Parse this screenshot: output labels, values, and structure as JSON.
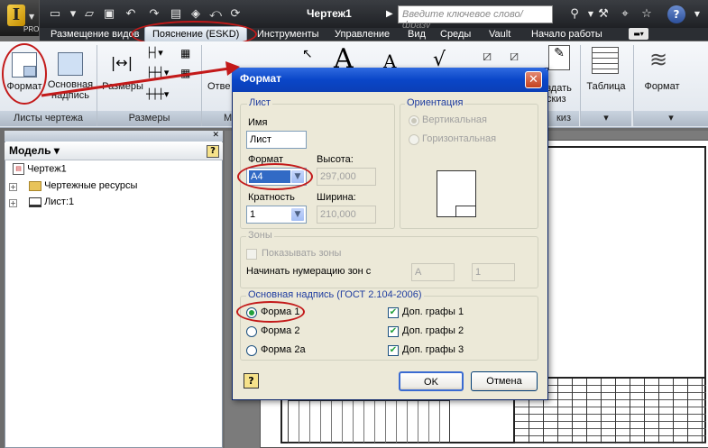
{
  "title_bar": {
    "app_label": "PRO",
    "document_title": "Чертеж1",
    "search_placeholder": "Введите ключевое слово/фразу",
    "help": "?"
  },
  "tabs": [
    "Размещение видов",
    "Пояснение (ESKD)",
    "Инструменты",
    "Управление",
    "Вид",
    "Среды",
    "Vault",
    "Начало работы"
  ],
  "active_tab": "Пояснение (ESKD)",
  "ribbon": {
    "format_button": "Формат",
    "title_block_button_l1": "Основная",
    "title_block_button_l2": "надпись",
    "dimensions_button": "Размеры",
    "panel_sheets": "Листы чертежа",
    "panel_dimensions": "Размеры",
    "panel_m": "М",
    "otv_partial": "Отве",
    "tablica": "Таблица",
    "format_right": "Формат",
    "sozdat_l1": "здать",
    "sozdat_l2": "скиз",
    "panel_kiz": "киз"
  },
  "browser": {
    "title": "Модель",
    "help": "?",
    "items": [
      {
        "label": "Чертеж1"
      },
      {
        "label": "Чертежные ресурсы"
      },
      {
        "label": "Лист:1"
      }
    ]
  },
  "dialog": {
    "title": "Формат",
    "sheet_group": "Лист",
    "name_label": "Имя",
    "name_value": "Лист",
    "format_label": "Формат",
    "format_value": "A4",
    "height_label": "Высота:",
    "height_value": "297,000",
    "multiplicity_label": "Кратность",
    "multiplicity_value": "1",
    "width_label": "Ширина:",
    "width_value": "210,000",
    "orientation_group": "Ориентация",
    "vertical": "Вертикальная",
    "horizontal": "Горизонтальная",
    "zones_group": "Зоны",
    "show_zones": "Показывать зоны",
    "zone_numbering": "Начинать нумерацию зон с",
    "zone_letter": "A",
    "zone_number": "1",
    "title_block_group": "Основная надпись (ГОСТ 2.104-2006)",
    "form1": "Форма 1",
    "form2": "Форма 2",
    "form2a": "Форма 2а",
    "extra1": "Доп. графы 1",
    "extra2": "Доп. графы 2",
    "extra3": "Доп. графы 3",
    "help": "?",
    "ok": "OK",
    "cancel": "Отмена"
  },
  "accent_colors": {
    "highlight": "#c31a1a",
    "dialog_title": "#0a46c8",
    "check": "#22a03a"
  }
}
